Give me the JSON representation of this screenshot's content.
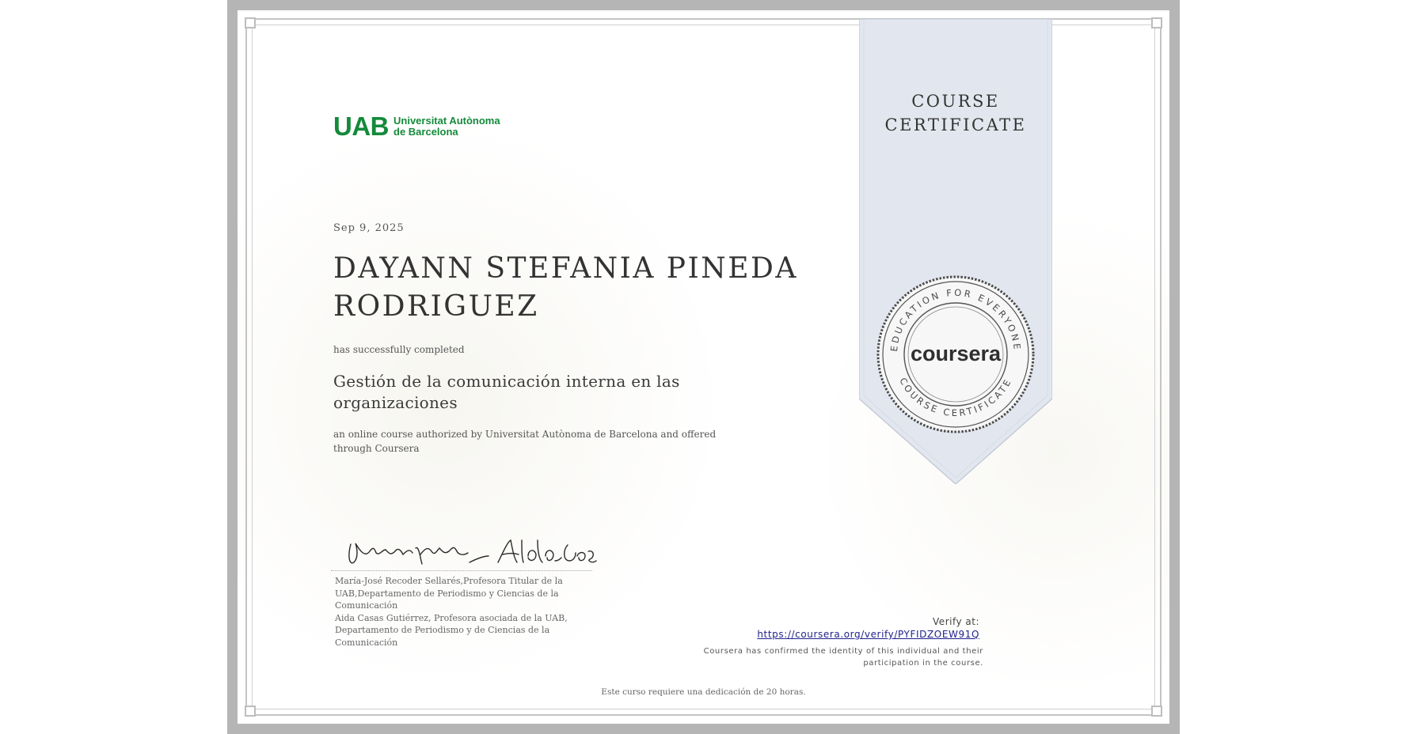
{
  "institution": {
    "logo_mark": "UAB",
    "logo_line1": "Universitat Autònoma",
    "logo_line2": "de Barcelona",
    "brand_color": "#148a3b"
  },
  "certificate": {
    "banner_line1": "COURSE",
    "banner_line2": "CERTIFICATE",
    "date": "Sep 9, 2025",
    "recipient_name": "DAYANN STEFANIA PINEDA RODRIGUEZ",
    "completed_text": "has successfully completed",
    "course_title": "Gestión de la comunicación interna en las organizaciones",
    "authorized_text": "an online course authorized by Universitat Autònoma de Barcelona and offered through Coursera"
  },
  "signers": {
    "line1": "María-José Recoder Sellarés,Profesora Titular de la",
    "line2": "UAB,Departamento de Periodismo y Ciencias de la",
    "line3": "Comunicación",
    "line4": "Aida Casas Gutiérrez, Profesora asociada de la UAB,",
    "line5": "Departamento de Periodismo y de Ciencias de la Comunicación"
  },
  "seal": {
    "top_text": "EDUCATION FOR EVERYONE",
    "bottom_text": "COURSE CERTIFICATE",
    "center_text": "coursera"
  },
  "verification": {
    "label": "Verify at:",
    "url": "https://coursera.org/verify/PYFIDZOEW91Q",
    "note_line1": "Coursera has confirmed the identity of this individual and their",
    "note_line2": "participation in the course."
  },
  "footer": {
    "hours_text": "Este curso requiere una dedicación de 20 horas."
  }
}
